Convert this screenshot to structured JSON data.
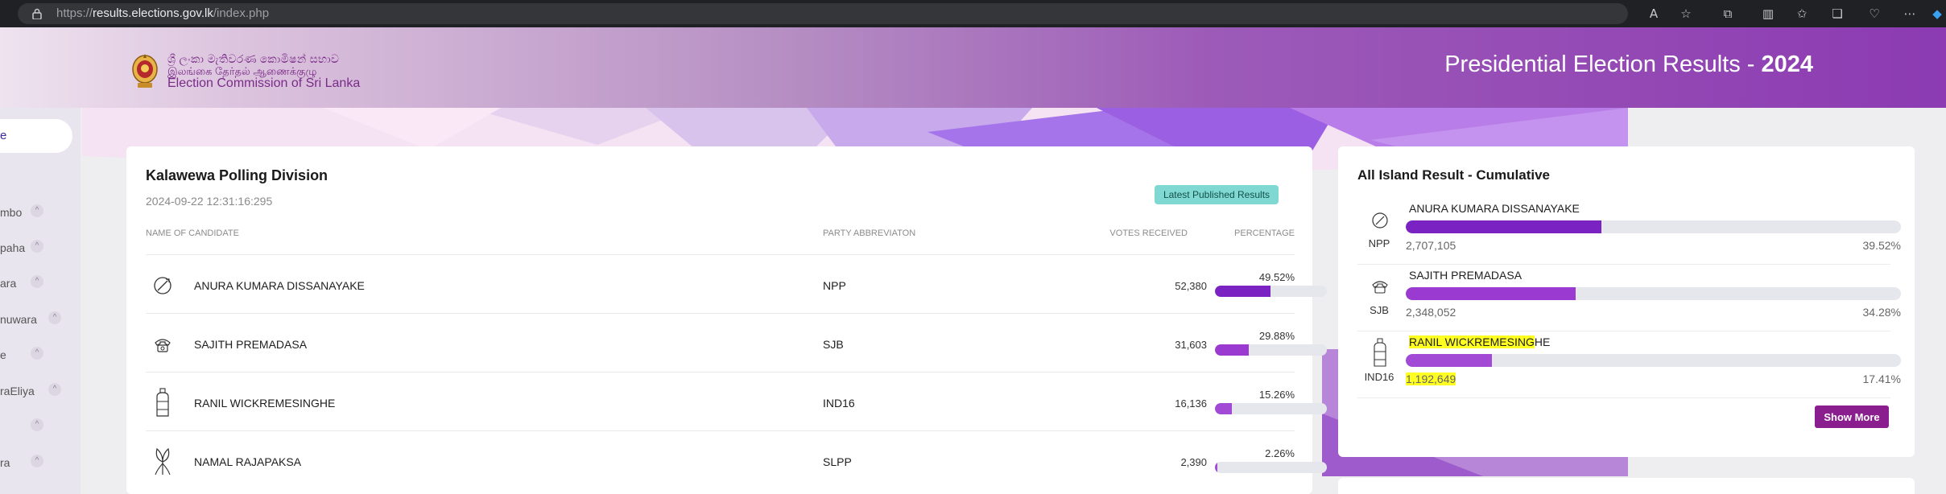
{
  "browser": {
    "url_prefix": "https://",
    "url_domain": "results.elections.gov.lk",
    "url_path": "/index.php"
  },
  "header": {
    "logo_line1": "ශ්‍රී ලංකා මැතිවරණ කොමිෂන් සභාව",
    "logo_line2": "இலங்கை தேர்தல் ஆணைக்குழு",
    "logo_line3": "Election Commission of Sri Lanka",
    "title_prefix": "Presidential Election Results - ",
    "title_year": "2024"
  },
  "sidenav": {
    "active_fragment": "e",
    "items": [
      "mbo",
      "paha",
      "ara",
      "nuwara",
      "e",
      "raEliya",
      "",
      "ra"
    ]
  },
  "division": {
    "title": "Kalawewa Polling Division",
    "timestamp": "2024-09-22 12:31:16:295",
    "badge": "Latest Published Results",
    "columns": {
      "candidate": "NAME OF CANDIDATE",
      "party": "PARTY ABBREVIATON",
      "votes": "VOTES RECEIVED",
      "percentage": "PERCENTAGE"
    },
    "rows": [
      {
        "name": "ANURA KUMARA DISSANAYAKE",
        "party": "NPP",
        "votes": "52,380",
        "pct": "49.52%",
        "value": 49.52,
        "symbol": "compass-symbol-icon",
        "color": "#7a22c2"
      },
      {
        "name": "SAJITH PREMADASA",
        "party": "SJB",
        "votes": "31,603",
        "pct": "29.88%",
        "value": 29.88,
        "symbol": "telephone-symbol-icon",
        "color": "#9a3ad0"
      },
      {
        "name": "RANIL WICKREMESINGHE",
        "party": "IND16",
        "votes": "16,136",
        "pct": "15.26%",
        "value": 15.26,
        "symbol": "gas-cylinder-symbol-icon",
        "color": "#a24ad6"
      },
      {
        "name": "NAMAL RAJAPAKSA",
        "party": "SLPP",
        "votes": "2,390",
        "pct": "2.26%",
        "value": 2.26,
        "symbol": "flower-bud-symbol-icon",
        "color": "#a24ad6"
      }
    ]
  },
  "island": {
    "title": "All Island Result - Cumulative",
    "rows": [
      {
        "name": "ANURA KUMARA DISSANAYAKE",
        "party": "NPP",
        "votes": "2,707,105",
        "pct": "39.52%",
        "value": 39.52,
        "color": "#7a22c2"
      },
      {
        "name_part1": "RANIL WICKREMESING",
        "name_part2": "HE"
      },
      {
        "name": "SAJITH PREMADASA",
        "party": "SJB",
        "votes": "2,348,052",
        "pct": "34.28%",
        "value": 34.28,
        "color": "#9a3ad0"
      }
    ],
    "third": {
      "party": "IND16",
      "votes": "1,192,649",
      "pct": "17.41%",
      "value": 17.41,
      "color": "#a24ad6"
    },
    "show_more": "Show More"
  },
  "colors": {
    "accent": "#8a1e8e",
    "badge": "#7fd9d2",
    "bar_track": "#e6e7ec"
  }
}
